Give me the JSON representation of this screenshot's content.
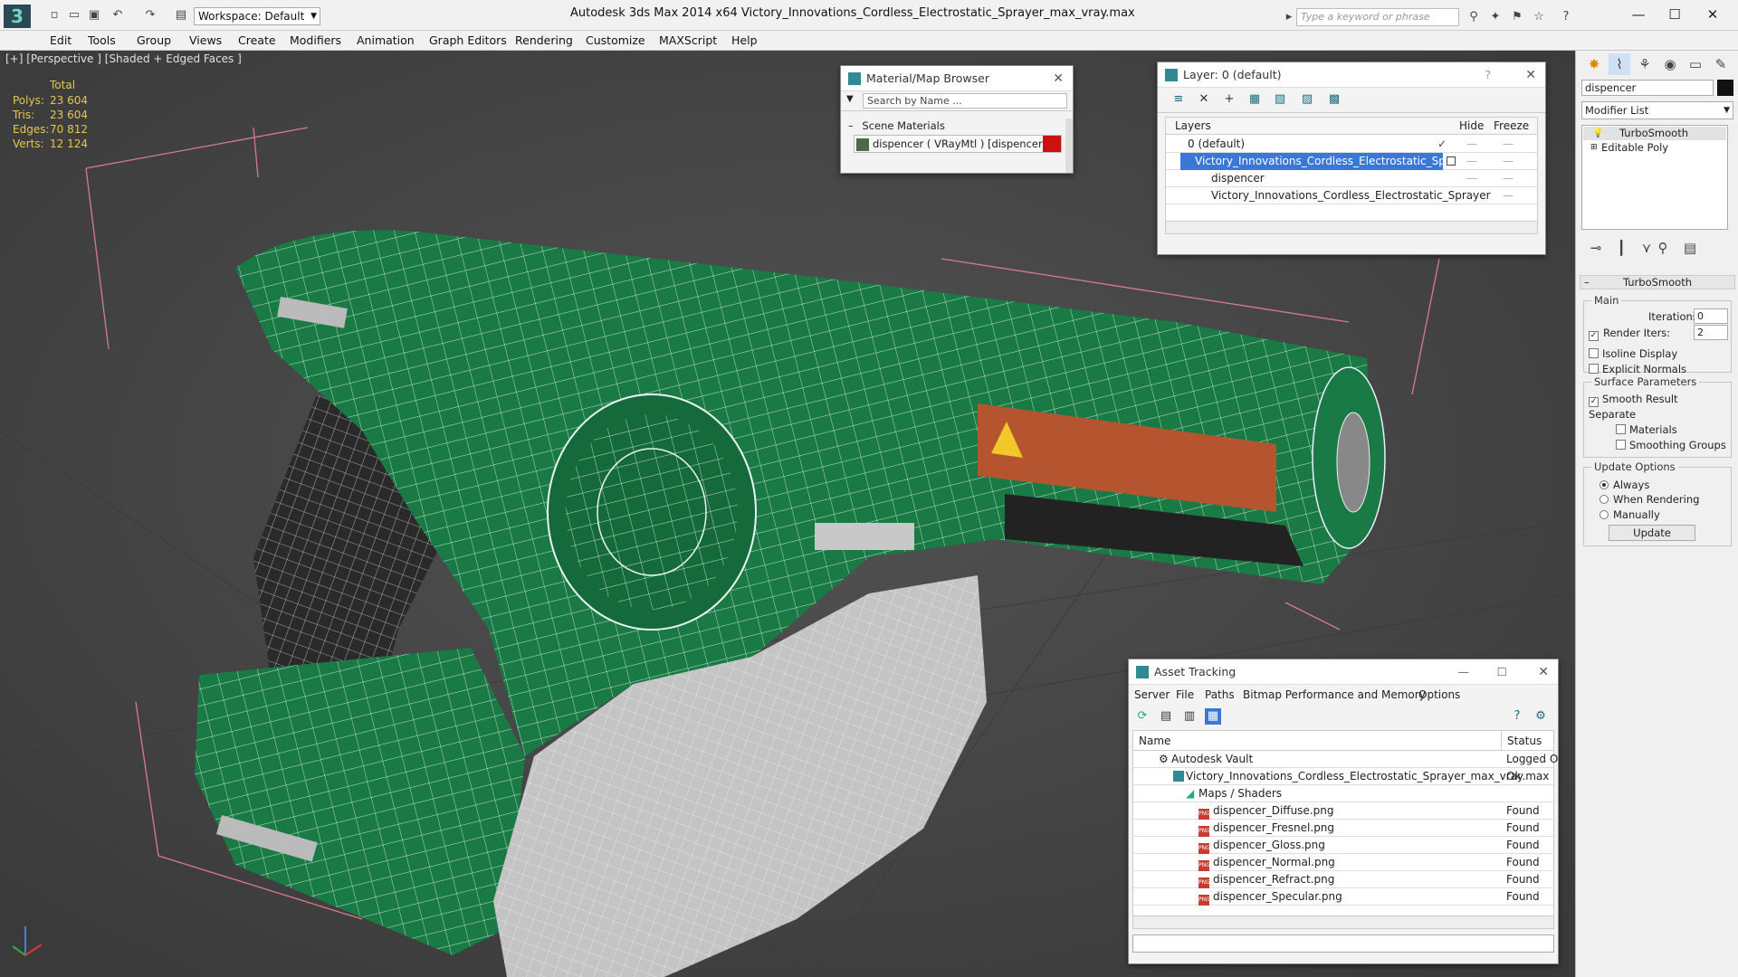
{
  "titlebar": {
    "workspace": "Workspace: Default",
    "title": "Autodesk 3ds Max  2014 x64     Victory_Innovations_Cordless_Electrostatic_Sprayer_max_vray.max",
    "search_placeholder": "Type a keyword or phrase",
    "minimize": "—",
    "maximize": "☐",
    "close": "✕"
  },
  "menu": [
    "Edit",
    "Tools",
    "Group",
    "Views",
    "Create",
    "Modifiers",
    "Animation",
    "Graph Editors",
    "Rendering",
    "Customize",
    "MAXScript",
    "Help"
  ],
  "viewport": {
    "label": "[+] [Perspective ] [Shaded + Edged Faces ]",
    "stats_header": "Total",
    "stats": [
      {
        "label": "Polys:",
        "value": "23 604"
      },
      {
        "label": "Tris:",
        "value": "23 604"
      },
      {
        "label": "Edges:",
        "value": "70 812"
      },
      {
        "label": "Verts:",
        "value": "12 124"
      }
    ]
  },
  "material_browser": {
    "title": "Material/Map Browser",
    "search_placeholder": "Search by Name ...",
    "section": "Scene Materials",
    "item": "dispencer ( VRayMtl ) [dispencer]",
    "item_color": "#cc1111"
  },
  "layer_panel": {
    "title": "Layer: 0 (default)",
    "help": "?",
    "col_layers": "Layers",
    "col_hide": "Hide",
    "col_freeze": "Freeze",
    "rows": [
      {
        "name": "0 (default)"
      },
      {
        "name": "Victory_Innovations_Cordless_Electrostatic_Sprayer"
      },
      {
        "name": "dispencer"
      },
      {
        "name": "Victory_Innovations_Cordless_Electrostatic_Sprayer"
      }
    ]
  },
  "asset_tracking": {
    "title": "Asset Tracking",
    "menu": [
      "Server",
      "File",
      "Paths",
      "Bitmap Performance and Memory",
      "Options"
    ],
    "col_name": "Name",
    "col_status": "Status",
    "rows": [
      {
        "name": "Autodesk Vault",
        "status": "Logged O"
      },
      {
        "name": "Victory_Innovations_Cordless_Electrostatic_Sprayer_max_vray.max",
        "status": "Ok"
      },
      {
        "name": "Maps / Shaders",
        "status": ""
      },
      {
        "name": "dispencer_Diffuse.png",
        "status": "Found"
      },
      {
        "name": "dispencer_Fresnel.png",
        "status": "Found"
      },
      {
        "name": "dispencer_Gloss.png",
        "status": "Found"
      },
      {
        "name": "dispencer_Normal.png",
        "status": "Found"
      },
      {
        "name": "dispencer_Refract.png",
        "status": "Found"
      },
      {
        "name": "dispencer_Specular.png",
        "status": "Found"
      }
    ]
  },
  "command_panel": {
    "object_name": "dispencer",
    "modifier_list": "Modifier List",
    "stack": [
      "TurboSmooth",
      "Editable Poly"
    ],
    "rollout_title": "TurboSmooth",
    "main_group": "Main",
    "iterations_label": "Iterations:",
    "iterations": "0",
    "render_iters_label": "Render Iters:",
    "render_iters": "2",
    "isoline": "Isoline Display",
    "explicit_normals": "Explicit Normals",
    "surface_group": "Surface Parameters",
    "smooth_result": "Smooth Result",
    "separate": "Separate",
    "materials": "Materials",
    "smoothing_groups": "Smoothing Groups",
    "update_group": "Update Options",
    "always": "Always",
    "when_rendering": "When Rendering",
    "manually": "Manually",
    "update_button": "Update"
  },
  "colors": {
    "model_green": "#1a7a45",
    "selection_blue": "#3a78d8",
    "stats_yellow": "#e6c84a"
  }
}
